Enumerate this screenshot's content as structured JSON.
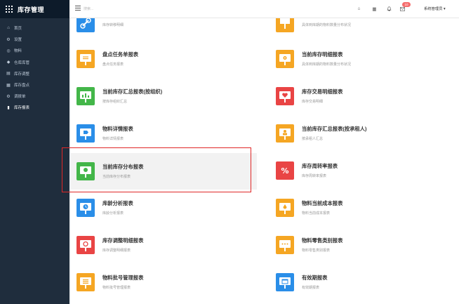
{
  "app": {
    "title": "库存管理"
  },
  "sidebar": {
    "items": [
      {
        "label": "首页",
        "icon": "home-icon",
        "glyph": "⌂"
      },
      {
        "label": "设置",
        "icon": "gear-icon",
        "glyph": "⚙"
      },
      {
        "label": "物料",
        "icon": "box-icon",
        "glyph": "◎"
      },
      {
        "label": "仓库库管",
        "icon": "warehouse-icon",
        "glyph": "◆"
      },
      {
        "label": "库存调整",
        "icon": "adjust-icon",
        "glyph": "▤"
      },
      {
        "label": "库存盘点",
        "icon": "inventory-icon",
        "glyph": "▦"
      },
      {
        "label": "调拨单",
        "icon": "transfer-icon",
        "glyph": "⚙"
      },
      {
        "label": "库存报表",
        "icon": "report-icon",
        "glyph": "▮",
        "active": true
      }
    ]
  },
  "header": {
    "search_placeholder": "搜索...",
    "badge_count": "10",
    "user_label": "系统管理员 ▾",
    "icons": [
      "home-icon",
      "grid-icon",
      "bell-icon",
      "mail-icon"
    ]
  },
  "cards": [
    {
      "title": "",
      "subtitle": "库存转移明细",
      "color": "#2a8ee8",
      "icon": "link-icon",
      "partial": true
    },
    {
      "title": "",
      "subtitle": "具体到库期的物料数量分布状况",
      "color": "#f5a623",
      "icon": "signpost-icon",
      "partial": true
    },
    {
      "title": "盘点任务单报表",
      "subtitle": "盘点任务报表",
      "color": "#f5a623",
      "icon": "signboard-icon"
    },
    {
      "title": "当前库存明细报表",
      "subtitle": "具体到库期的物料数量分布状况",
      "color": "#f5a623",
      "icon": "signboard-gear-icon"
    },
    {
      "title": "当前库存汇总报表(按组织)",
      "subtitle": "按库存组织汇总",
      "color": "#43b649",
      "icon": "bar-chart-icon"
    },
    {
      "title": "库存交易明细报表",
      "subtitle": "库存交易明细",
      "color": "#e94444",
      "icon": "heart-board-icon"
    },
    {
      "title": "物料详情报表",
      "subtitle": "物料详情报表",
      "color": "#2a8ee8",
      "icon": "tag-board-icon"
    },
    {
      "title": "当前库存汇总报表(按承租人)",
      "subtitle": "按承租人汇总",
      "color": "#f5a623",
      "icon": "person-board-icon"
    },
    {
      "title": "当前库存分布报表",
      "subtitle": "当前库存分布报表",
      "color": "#43b649",
      "icon": "location-board-icon",
      "highlight": true
    },
    {
      "title": "库存周转率报表",
      "subtitle": "库存周转率报表",
      "color": "#e94444",
      "icon": "percent-icon"
    },
    {
      "title": "库龄分析报表",
      "subtitle": "库龄分析报表",
      "color": "#2a8ee8",
      "icon": "clock-board-icon"
    },
    {
      "title": "物料当前成本报表",
      "subtitle": "物料当前成本报表",
      "color": "#f5a623",
      "icon": "drop-board-icon"
    },
    {
      "title": "库存调整明细报表",
      "subtitle": "库存调整明细报表",
      "color": "#e94444",
      "icon": "refresh-board-icon"
    },
    {
      "title": "物料零售类别报表",
      "subtitle": "物料零售类别报表",
      "color": "#f5a623",
      "icon": "dots-board-icon"
    },
    {
      "title": "物料批号管理报表",
      "subtitle": "物料批号管理报表",
      "color": "#f5a623",
      "icon": "list-board-icon"
    },
    {
      "title": "有效期报表",
      "subtitle": "有效期报表",
      "color": "#2a8ee8",
      "icon": "calendar-board-icon"
    }
  ]
}
